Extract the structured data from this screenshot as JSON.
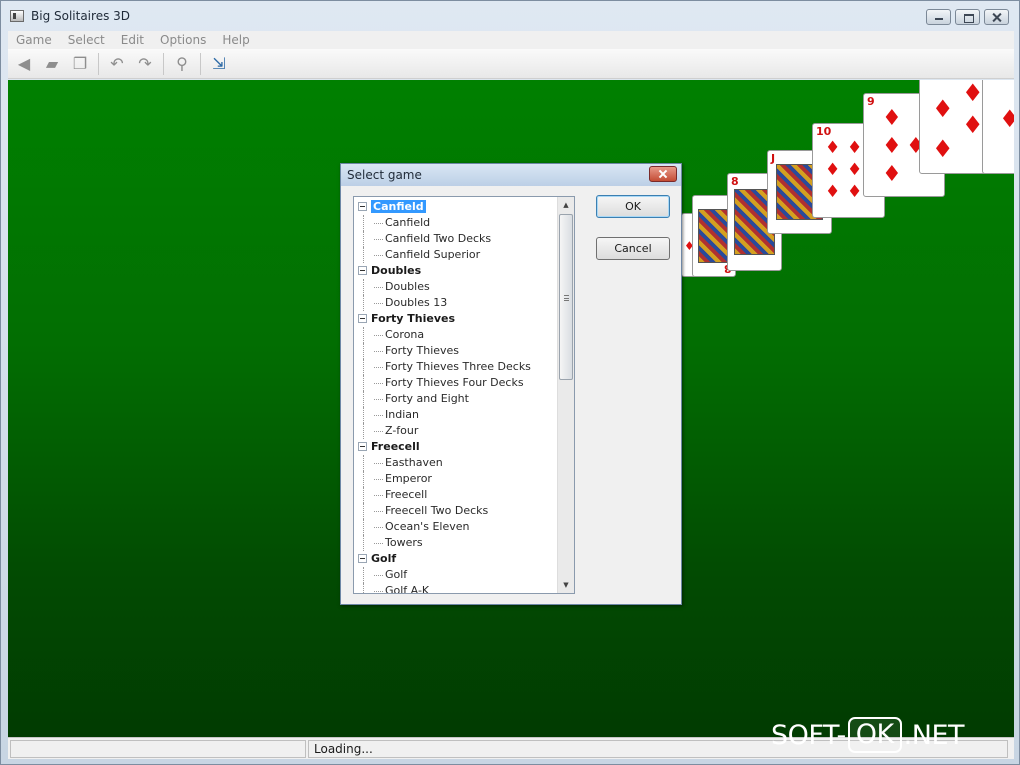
{
  "window": {
    "title": "Big Solitaires 3D"
  },
  "menu": [
    "Game",
    "Select",
    "Edit",
    "Options",
    "Help"
  ],
  "toolbar": {
    "buttons": [
      {
        "name": "new-game-icon",
        "glyph": "◀"
      },
      {
        "name": "open-folder-icon",
        "glyph": "▰"
      },
      {
        "name": "copy-icon",
        "glyph": "❐"
      },
      {
        "name": "undo-icon",
        "glyph": "↶"
      },
      {
        "name": "redo-icon",
        "glyph": "↷"
      },
      {
        "name": "hint-icon",
        "glyph": "⚲"
      },
      {
        "name": "exit-icon",
        "glyph": "⇲"
      }
    ]
  },
  "cards": {
    "ranks": [
      "9",
      "8",
      "8",
      "J",
      "10",
      "9"
    ]
  },
  "dialog": {
    "title": "Select game",
    "ok_label": "OK",
    "cancel_label": "Cancel",
    "tree": [
      {
        "group": "Canfield",
        "selected": true,
        "children": [
          "Canfield",
          "Canfield Two Decks",
          "Canfield Superior"
        ]
      },
      {
        "group": "Doubles",
        "children": [
          "Doubles",
          "Doubles 13"
        ]
      },
      {
        "group": "Forty Thieves",
        "children": [
          "Corona",
          "Forty Thieves",
          "Forty Thieves Three Decks",
          "Forty Thieves Four Decks",
          "Forty and Eight",
          "Indian",
          "Z-four"
        ]
      },
      {
        "group": "Freecell",
        "children": [
          "Easthaven",
          "Emperor",
          "Freecell",
          "Freecell Two Decks",
          "Ocean's Eleven",
          "Towers"
        ]
      },
      {
        "group": "Golf",
        "children": [
          "Golf",
          "Golf A-K"
        ]
      }
    ]
  },
  "status": {
    "text": "Loading..."
  },
  "watermark": {
    "left": "SOFT-",
    "boxed": "OK",
    "right": ".NET"
  },
  "colors": {
    "felt": "#008000",
    "selection": "#3399ff",
    "card_red": "#e01010"
  }
}
